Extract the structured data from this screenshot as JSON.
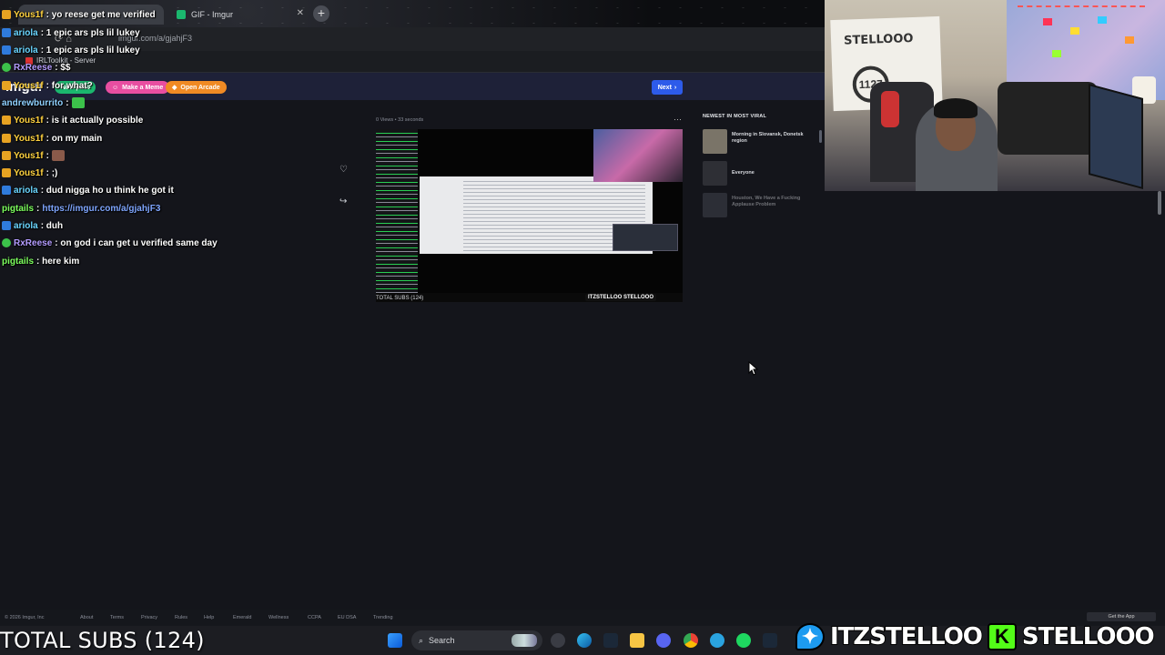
{
  "browser": {
    "tabs": [
      {
        "label": "yo reese get me verified",
        "active": true
      },
      {
        "label": "GIF - Imgur",
        "active": false
      }
    ],
    "url": "imgur.com/a/gjahjF3",
    "bookmark": "IRLToolkit - Server"
  },
  "imgur": {
    "logo": "imgur",
    "new_post": "New post",
    "make_meme": "Make a Meme",
    "open_arcade": "Open Arcade",
    "next": "Next",
    "post_meta": "0 Views • 33 seconds",
    "post_caption": "TOTAL SUBS (124)",
    "post_tag": "ITZSTELLOO  STELLOOO",
    "viral_title": "NEWEST IN MOST VIRAL",
    "viral_items": [
      {
        "title": "Morning in Slovansk, Donetsk region",
        "color": "#7a7468"
      },
      {
        "title": "Everyone",
        "color": "#2e2f35"
      },
      {
        "title": "Houston, We Have a Fucking Applause Problem",
        "color": "#4a4e57"
      }
    ],
    "footer": [
      "© 2026 Imgur, Inc",
      "About",
      "Terms",
      "Privacy",
      "Rules",
      "Help",
      "Emerald",
      "Wellness",
      "CCPA",
      "EU DSA",
      "Trending"
    ],
    "get_app": "Get the App"
  },
  "chat": [
    {
      "user": "Yous1f",
      "badge": "gold",
      "color": "#ffd23f",
      "text": ": yo reese get me verified",
      "emote": ""
    },
    {
      "user": "ariola",
      "badge": "blue",
      "color": "#6ad6ff",
      "text": ": 1 epic ars pls lil lukey",
      "emote": ""
    },
    {
      "user": "ariola",
      "badge": "blue",
      "color": "#6ad6ff",
      "text": ": 1 epic ars pls lil lukey",
      "emote": ""
    },
    {
      "user": "RxReese",
      "badge": "green",
      "color": "#b49cff",
      "text": ": $$",
      "emote": ""
    },
    {
      "user": "Yous1f",
      "badge": "gold",
      "color": "#ffd23f",
      "text": ": for what?",
      "emote": ""
    },
    {
      "user": "andrewburrito",
      "badge": "",
      "color": "#8fd1ff",
      "text": ":",
      "emote": "#3cc24a"
    },
    {
      "user": "Yous1f",
      "badge": "gold",
      "color": "#ffd23f",
      "text": ": is it actually possible",
      "emote": ""
    },
    {
      "user": "Yous1f",
      "badge": "gold",
      "color": "#ffd23f",
      "text": ": on my main",
      "emote": ""
    },
    {
      "user": "Yous1f",
      "badge": "gold",
      "color": "#ffd23f",
      "text": ":",
      "emote": "#8a5a4a"
    },
    {
      "user": "Yous1f",
      "badge": "gold",
      "color": "#ffd23f",
      "text": ": ;)",
      "emote": ""
    },
    {
      "user": "ariola",
      "badge": "blue",
      "color": "#6ad6ff",
      "text": ": dud nigga ho u think he got it",
      "emote": ""
    },
    {
      "user": "pigtails",
      "badge": "",
      "color": "#7dff5e",
      "text": ":",
      "link": "https://imgur.com/a/gjahjF3",
      "emote": ""
    },
    {
      "user": "ariola",
      "badge": "blue",
      "color": "#6ad6ff",
      "text": ": duh",
      "emote": ""
    },
    {
      "user": "RxReese",
      "badge": "green",
      "color": "#b49cff",
      "text": ": on god i can get u verified same day",
      "emote": ""
    },
    {
      "user": "pigtails",
      "badge": "",
      "color": "#7dff5e",
      "text": ": here kim",
      "emote": ""
    }
  ],
  "webcam": {
    "canvas_text": "STELLOOO",
    "canvas_circle": "1127"
  },
  "taskbar": {
    "search": "Search"
  },
  "overlay": {
    "subs": "TOTAL SUBS (124)",
    "twitter_handle": "ITZSTELLOO",
    "kick_handle": "STELLOOO",
    "kick_letter": "K"
  }
}
